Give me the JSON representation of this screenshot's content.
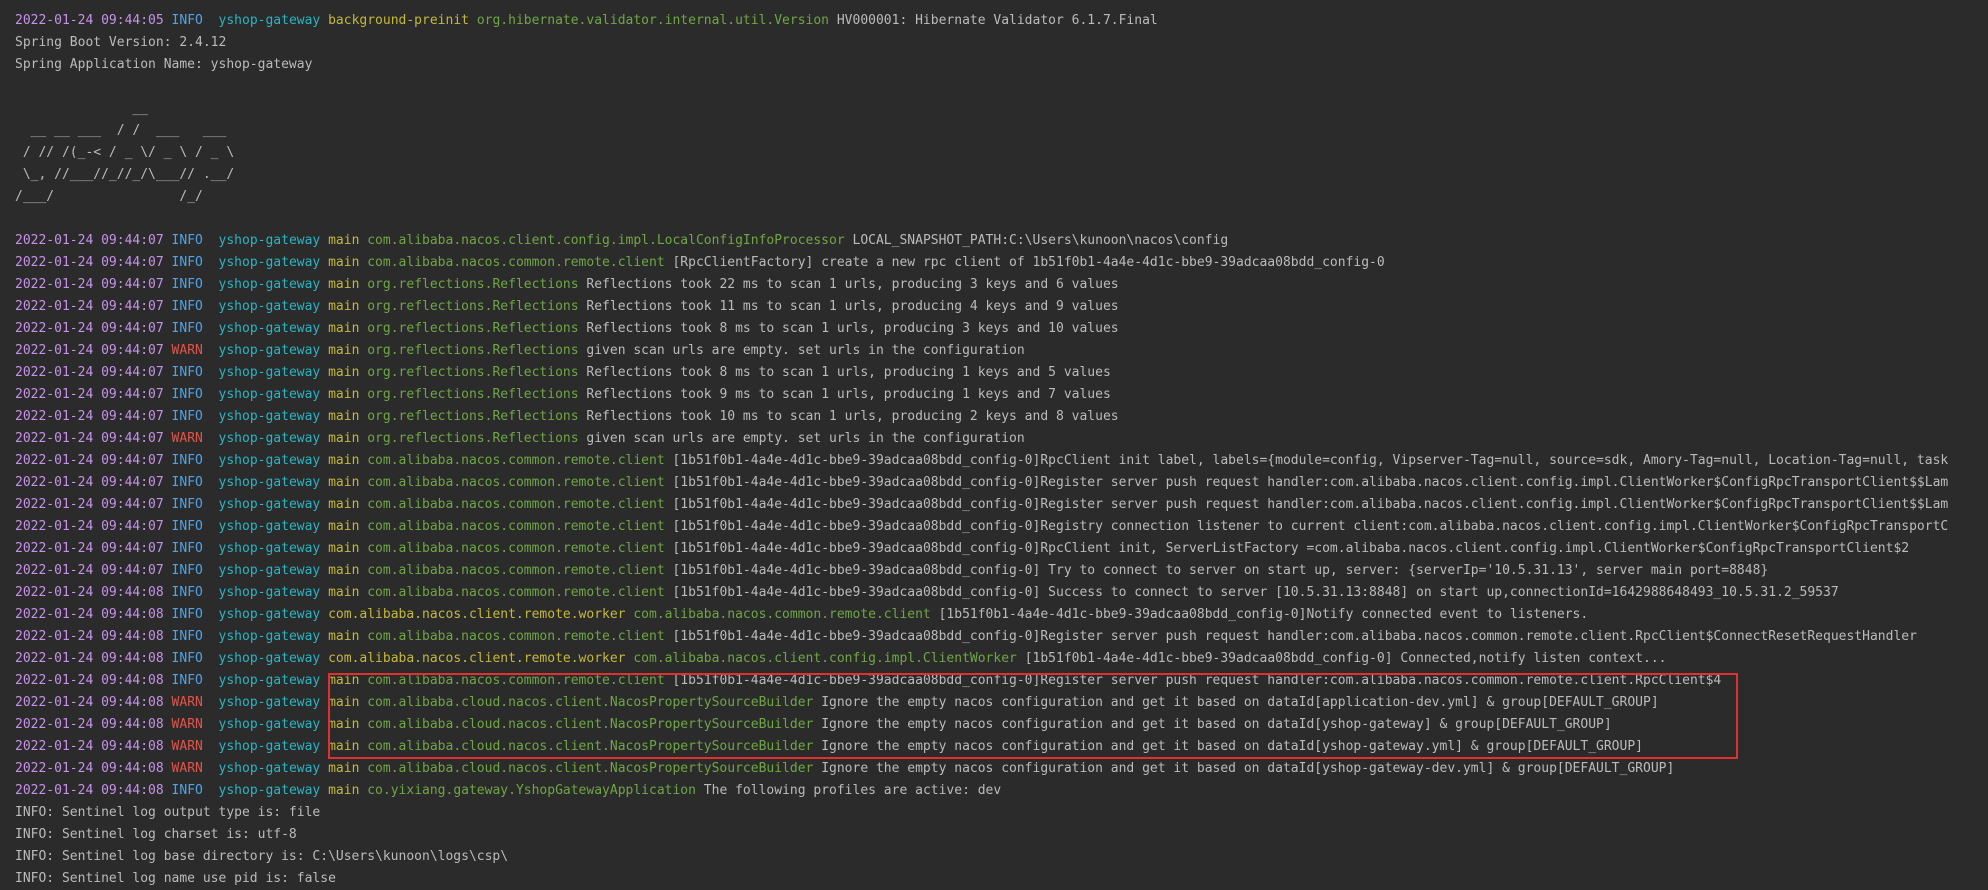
{
  "colors": {
    "background": "#2b2b2b",
    "timestamp": "#c792ea",
    "info": "#4fa3e6",
    "warn": "#e0544c",
    "app": "#28b5c4",
    "thread": "#c5b83a",
    "logger": "#6fa645",
    "text": "#bbbbbb",
    "highlight_border": "#e03131"
  },
  "lines": [
    {
      "kind": "log",
      "ts": "2022-01-24 09:44:05",
      "level": "INFO",
      "app": "yshop-gateway",
      "thread": "background-preinit",
      "logger": "org.hibernate.validator.internal.util.Version",
      "msg": "HV000001: Hibernate Validator 6.1.7.Final"
    },
    {
      "kind": "plain",
      "text": "Spring Boot Version: 2.4.12"
    },
    {
      "kind": "plain",
      "text": "Spring Application Name: yshop-gateway"
    },
    {
      "kind": "plain",
      "text": ""
    },
    {
      "kind": "banner",
      "text": "               __"
    },
    {
      "kind": "banner",
      "text": "  __ __ ___  / /  ___   ___"
    },
    {
      "kind": "banner",
      "text": " / // /(_-< / _ \\/ _ \\ / _ \\"
    },
    {
      "kind": "banner",
      "text": " \\_, //___//_//_/\\___// .__/"
    },
    {
      "kind": "banner",
      "text": "/___/                /_/"
    },
    {
      "kind": "plain",
      "text": ""
    },
    {
      "kind": "log",
      "ts": "2022-01-24 09:44:07",
      "level": "INFO",
      "app": "yshop-gateway",
      "thread": "main",
      "logger": "com.alibaba.nacos.client.config.impl.LocalConfigInfoProcessor",
      "msg": "LOCAL_SNAPSHOT_PATH:C:\\Users\\kunoon\\nacos\\config"
    },
    {
      "kind": "log",
      "ts": "2022-01-24 09:44:07",
      "level": "INFO",
      "app": "yshop-gateway",
      "thread": "main",
      "logger": "com.alibaba.nacos.common.remote.client",
      "msg": "[RpcClientFactory] create a new rpc client of 1b51f0b1-4a4e-4d1c-bbe9-39adcaa08bdd_config-0"
    },
    {
      "kind": "log",
      "ts": "2022-01-24 09:44:07",
      "level": "INFO",
      "app": "yshop-gateway",
      "thread": "main",
      "logger": "org.reflections.Reflections",
      "msg": "Reflections took 22 ms to scan 1 urls, producing 3 keys and 6 values"
    },
    {
      "kind": "log",
      "ts": "2022-01-24 09:44:07",
      "level": "INFO",
      "app": "yshop-gateway",
      "thread": "main",
      "logger": "org.reflections.Reflections",
      "msg": "Reflections took 11 ms to scan 1 urls, producing 4 keys and 9 values"
    },
    {
      "kind": "log",
      "ts": "2022-01-24 09:44:07",
      "level": "INFO",
      "app": "yshop-gateway",
      "thread": "main",
      "logger": "org.reflections.Reflections",
      "msg": "Reflections took 8 ms to scan 1 urls, producing 3 keys and 10 values"
    },
    {
      "kind": "log",
      "ts": "2022-01-24 09:44:07",
      "level": "WARN",
      "app": "yshop-gateway",
      "thread": "main",
      "logger": "org.reflections.Reflections",
      "msg": "given scan urls are empty. set urls in the configuration"
    },
    {
      "kind": "log",
      "ts": "2022-01-24 09:44:07",
      "level": "INFO",
      "app": "yshop-gateway",
      "thread": "main",
      "logger": "org.reflections.Reflections",
      "msg": "Reflections took 8 ms to scan 1 urls, producing 1 keys and 5 values"
    },
    {
      "kind": "log",
      "ts": "2022-01-24 09:44:07",
      "level": "INFO",
      "app": "yshop-gateway",
      "thread": "main",
      "logger": "org.reflections.Reflections",
      "msg": "Reflections took 9 ms to scan 1 urls, producing 1 keys and 7 values"
    },
    {
      "kind": "log",
      "ts": "2022-01-24 09:44:07",
      "level": "INFO",
      "app": "yshop-gateway",
      "thread": "main",
      "logger": "org.reflections.Reflections",
      "msg": "Reflections took 10 ms to scan 1 urls, producing 2 keys and 8 values"
    },
    {
      "kind": "log",
      "ts": "2022-01-24 09:44:07",
      "level": "WARN",
      "app": "yshop-gateway",
      "thread": "main",
      "logger": "org.reflections.Reflections",
      "msg": "given scan urls are empty. set urls in the configuration"
    },
    {
      "kind": "log",
      "ts": "2022-01-24 09:44:07",
      "level": "INFO",
      "app": "yshop-gateway",
      "thread": "main",
      "logger": "com.alibaba.nacos.common.remote.client",
      "msg": "[1b51f0b1-4a4e-4d1c-bbe9-39adcaa08bdd_config-0]RpcClient init label, labels={module=config, Vipserver-Tag=null, source=sdk, Amory-Tag=null, Location-Tag=null, task"
    },
    {
      "kind": "log",
      "ts": "2022-01-24 09:44:07",
      "level": "INFO",
      "app": "yshop-gateway",
      "thread": "main",
      "logger": "com.alibaba.nacos.common.remote.client",
      "msg": "[1b51f0b1-4a4e-4d1c-bbe9-39adcaa08bdd_config-0]Register server push request handler:com.alibaba.nacos.client.config.impl.ClientWorker$ConfigRpcTransportClient$$Lam"
    },
    {
      "kind": "log",
      "ts": "2022-01-24 09:44:07",
      "level": "INFO",
      "app": "yshop-gateway",
      "thread": "main",
      "logger": "com.alibaba.nacos.common.remote.client",
      "msg": "[1b51f0b1-4a4e-4d1c-bbe9-39adcaa08bdd_config-0]Register server push request handler:com.alibaba.nacos.client.config.impl.ClientWorker$ConfigRpcTransportClient$$Lam"
    },
    {
      "kind": "log",
      "ts": "2022-01-24 09:44:07",
      "level": "INFO",
      "app": "yshop-gateway",
      "thread": "main",
      "logger": "com.alibaba.nacos.common.remote.client",
      "msg": "[1b51f0b1-4a4e-4d1c-bbe9-39adcaa08bdd_config-0]Registry connection listener to current client:com.alibaba.nacos.client.config.impl.ClientWorker$ConfigRpcTransportC"
    },
    {
      "kind": "log",
      "ts": "2022-01-24 09:44:07",
      "level": "INFO",
      "app": "yshop-gateway",
      "thread": "main",
      "logger": "com.alibaba.nacos.common.remote.client",
      "msg": "[1b51f0b1-4a4e-4d1c-bbe9-39adcaa08bdd_config-0]RpcClient init, ServerListFactory =com.alibaba.nacos.client.config.impl.ClientWorker$ConfigRpcTransportClient$2"
    },
    {
      "kind": "log",
      "ts": "2022-01-24 09:44:07",
      "level": "INFO",
      "app": "yshop-gateway",
      "thread": "main",
      "logger": "com.alibaba.nacos.common.remote.client",
      "msg": "[1b51f0b1-4a4e-4d1c-bbe9-39adcaa08bdd_config-0] Try to connect to server on start up, server: {serverIp='10.5.31.13', server main port=8848}"
    },
    {
      "kind": "log",
      "ts": "2022-01-24 09:44:08",
      "level": "INFO",
      "app": "yshop-gateway",
      "thread": "main",
      "logger": "com.alibaba.nacos.common.remote.client",
      "msg": "[1b51f0b1-4a4e-4d1c-bbe9-39adcaa08bdd_config-0] Success to connect to server [10.5.31.13:8848] on start up,connectionId=1642988648493_10.5.31.2_59537"
    },
    {
      "kind": "log",
      "ts": "2022-01-24 09:44:08",
      "level": "INFO",
      "app": "yshop-gateway",
      "thread": "com.alibaba.nacos.client.remote.worker",
      "logger": "com.alibaba.nacos.common.remote.client",
      "msg": "[1b51f0b1-4a4e-4d1c-bbe9-39adcaa08bdd_config-0]Notify connected event to listeners."
    },
    {
      "kind": "log",
      "ts": "2022-01-24 09:44:08",
      "level": "INFO",
      "app": "yshop-gateway",
      "thread": "main",
      "logger": "com.alibaba.nacos.common.remote.client",
      "msg": "[1b51f0b1-4a4e-4d1c-bbe9-39adcaa08bdd_config-0]Register server push request handler:com.alibaba.nacos.common.remote.client.RpcClient$ConnectResetRequestHandler"
    },
    {
      "kind": "log",
      "ts": "2022-01-24 09:44:08",
      "level": "INFO",
      "app": "yshop-gateway",
      "thread": "com.alibaba.nacos.client.remote.worker",
      "logger": "com.alibaba.nacos.client.config.impl.ClientWorker",
      "msg": "[1b51f0b1-4a4e-4d1c-bbe9-39adcaa08bdd_config-0] Connected,notify listen context..."
    },
    {
      "kind": "log",
      "ts": "2022-01-24 09:44:08",
      "level": "INFO",
      "app": "yshop-gateway",
      "thread": "main",
      "logger": "com.alibaba.nacos.common.remote.client",
      "msg": "[1b51f0b1-4a4e-4d1c-bbe9-39adcaa08bdd_config-0]Register server push request handler:com.alibaba.nacos.common.remote.client.RpcClient$4"
    },
    {
      "kind": "log",
      "ts": "2022-01-24 09:44:08",
      "level": "WARN",
      "app": "yshop-gateway",
      "thread": "main",
      "logger": "com.alibaba.cloud.nacos.client.NacosPropertySourceBuilder",
      "msg": "Ignore the empty nacos configuration and get it based on dataId[application-dev.yml] & group[DEFAULT_GROUP]"
    },
    {
      "kind": "log",
      "ts": "2022-01-24 09:44:08",
      "level": "WARN",
      "app": "yshop-gateway",
      "thread": "main",
      "logger": "com.alibaba.cloud.nacos.client.NacosPropertySourceBuilder",
      "msg": "Ignore the empty nacos configuration and get it based on dataId[yshop-gateway] & group[DEFAULT_GROUP]"
    },
    {
      "kind": "log",
      "ts": "2022-01-24 09:44:08",
      "level": "WARN",
      "app": "yshop-gateway",
      "thread": "main",
      "logger": "com.alibaba.cloud.nacos.client.NacosPropertySourceBuilder",
      "msg": "Ignore the empty nacos configuration and get it based on dataId[yshop-gateway.yml] & group[DEFAULT_GROUP]"
    },
    {
      "kind": "log",
      "ts": "2022-01-24 09:44:08",
      "level": "WARN",
      "app": "yshop-gateway",
      "thread": "main",
      "logger": "com.alibaba.cloud.nacos.client.NacosPropertySourceBuilder",
      "msg": "Ignore the empty nacos configuration and get it based on dataId[yshop-gateway-dev.yml] & group[DEFAULT_GROUP]"
    },
    {
      "kind": "log",
      "ts": "2022-01-24 09:44:08",
      "level": "INFO",
      "app": "yshop-gateway",
      "thread": "main",
      "logger": "co.yixiang.gateway.YshopGatewayApplication",
      "msg": "The following profiles are active: dev"
    },
    {
      "kind": "plain",
      "text": "INFO: Sentinel log output type is: file"
    },
    {
      "kind": "plain",
      "text": "INFO: Sentinel log charset is: utf-8"
    },
    {
      "kind": "plain",
      "text": "INFO: Sentinel log base directory is: C:\\Users\\kunoon\\logs\\csp\\"
    },
    {
      "kind": "plain",
      "text": "INFO: Sentinel log name use pid is: false"
    }
  ]
}
